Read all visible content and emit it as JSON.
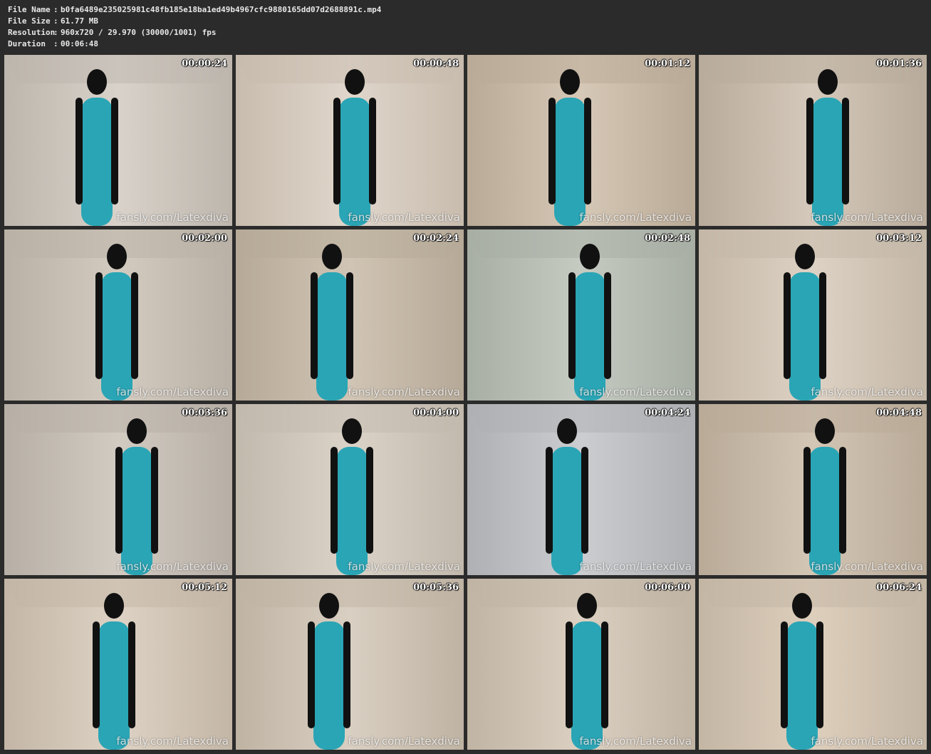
{
  "file_info": {
    "rows": [
      {
        "label": "File Name",
        "sep": ":",
        "value": "b0fa6489e235025981c48fb185e18ba1ed49b4967cfc9880165dd07d2688891c.mp4"
      },
      {
        "label": "File Size",
        "sep": ":",
        "value": "61.77 MB"
      },
      {
        "label": "Resolution",
        "sep": ":",
        "value": "960x720 / 29.970 (30000/1001) fps"
      },
      {
        "label": "Duration",
        "sep": ":",
        "value": "00:06:48"
      }
    ]
  },
  "thumbnails": [
    {
      "timestamp": "00:00:24",
      "watermark": "fansly.com/Latexdiva"
    },
    {
      "timestamp": "00:00:48",
      "watermark": "fansly.com/Latexdiva"
    },
    {
      "timestamp": "00:01:12",
      "watermark": "fansly.com/Latexdiva"
    },
    {
      "timestamp": "00:01:36",
      "watermark": "fansly.com/Latexdiva"
    },
    {
      "timestamp": "00:02:00",
      "watermark": "fansly.com/Latexdiva"
    },
    {
      "timestamp": "00:02:24",
      "watermark": "fansly.com/Latexdiva"
    },
    {
      "timestamp": "00:02:48",
      "watermark": "fansly.com/Latexdiva"
    },
    {
      "timestamp": "00:03:12",
      "watermark": "fansly.com/Latexdiva"
    },
    {
      "timestamp": "00:03:36",
      "watermark": "fansly.com/Latexdiva"
    },
    {
      "timestamp": "00:04:00",
      "watermark": "fansly.com/Latexdiva"
    },
    {
      "timestamp": "00:04:24",
      "watermark": "fansly.com/Latexdiva"
    },
    {
      "timestamp": "00:04:48",
      "watermark": "fansly.com/Latexdiva"
    },
    {
      "timestamp": "00:05:12",
      "watermark": "fansly.com/Latexdiva"
    },
    {
      "timestamp": "00:05:36",
      "watermark": "fansly.com/Latexdiva"
    },
    {
      "timestamp": "00:06:00",
      "watermark": "fansly.com/Latexdiva"
    },
    {
      "timestamp": "00:06:24",
      "watermark": "fansly.com/Latexdiva"
    }
  ],
  "colors": {
    "background": "#2b2b2b",
    "header_text": "#e8e8e8",
    "suit_teal": "#2aa5b5",
    "suit_black": "#111111"
  }
}
